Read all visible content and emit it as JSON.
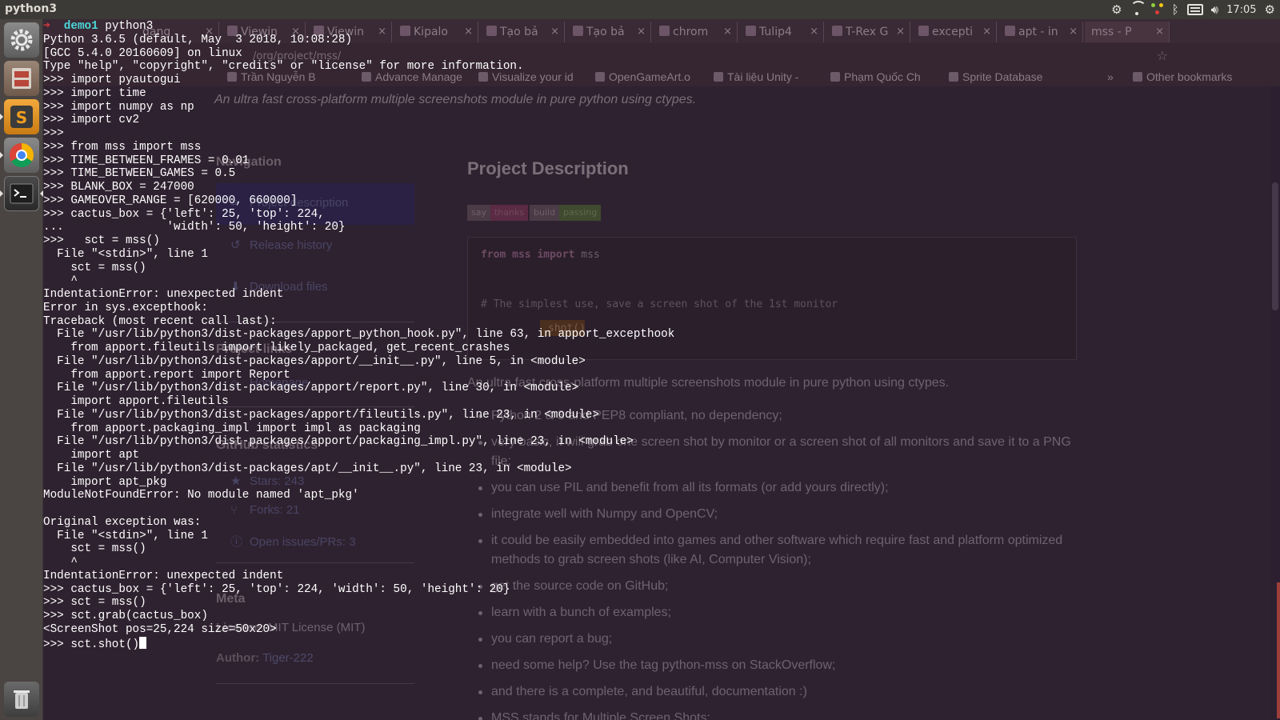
{
  "top_panel": {
    "app_title": "python3",
    "clock": "17:05",
    "tray_icons": [
      "settings-gear-icon",
      "wifi-icon",
      "network-shield-icon",
      "bluetooth-icon",
      "mail-icon",
      "volume-icon",
      "power-gear-icon"
    ]
  },
  "launcher": {
    "items": [
      "system-settings",
      "files",
      "sublime-text",
      "chrome",
      "terminal",
      "trash"
    ]
  },
  "browser": {
    "tabs": [
      {
        "label": "dang"
      },
      {
        "label": "Viewin"
      },
      {
        "label": "Viewin"
      },
      {
        "label": "Kipalo"
      },
      {
        "label": "Tạo bả"
      },
      {
        "label": "Tạo bả"
      },
      {
        "label": "chrom"
      },
      {
        "label": "Tulip4"
      },
      {
        "label": "T-Rex G"
      },
      {
        "label": "excepti"
      },
      {
        "label": "apt - in"
      },
      {
        "label": "mss - P"
      }
    ],
    "url": "/org/project/mss/",
    "bookmarks": [
      {
        "label": "Trần Nguyễn B"
      },
      {
        "label": "Advance Manage"
      },
      {
        "label": "Visualize your id"
      },
      {
        "label": "OpenGameArt.o"
      },
      {
        "label": "Tài liệu Unity -"
      },
      {
        "label": "Phạm Quốc Ch"
      },
      {
        "label": "Sprite Database"
      },
      {
        "label": "»"
      },
      {
        "label": "Other bookmarks"
      }
    ],
    "page": {
      "summary": "An ultra fast cross-platform multiple screenshots module in pure python using ctypes.",
      "sidebar": {
        "navigation_heading": "Navigation",
        "project_description_link": "Project description",
        "release_history_link": "Release history",
        "download_files_link": "Download files",
        "project_links_heading": "Project links",
        "homepage_link": "Homepage",
        "github_heading": "GitHub statistics",
        "stars": "Stars: 243",
        "forks": "Forks: 21",
        "issues": "Open issues/PRs: 3",
        "meta_heading": "Meta",
        "license_label": "License:",
        "license_value": "MIT License (MIT)",
        "author_label": "Author:",
        "author_value": "Tiger-222"
      },
      "main": {
        "title": "Project Description",
        "badge1_left": "say",
        "badge1_right": "thanks",
        "badge2_left": "build",
        "badge2_right": "passing",
        "code_kw_from": "from",
        "code_mod": "mss",
        "code_kw_import": "import",
        "code_name": "mss",
        "code_comment": "# The simplest use, save a screen shot of the 1st monitor",
        "code_call": "shot()",
        "paragraph": "An ultra fast cross-platform multiple screenshots module in pure python using ctypes.",
        "bullets": [
          {
            "text": "Python 2 & 3 and PEP8 compliant, no dependency;"
          },
          {
            "text": "very basic, it will grab one screen shot by monitor or a screen shot of all monitors and save it to a PNG file;"
          },
          {
            "text": "you can use PIL and benefit from all its formats (or add yours directly);"
          },
          {
            "text": "integrate well with Numpy and OpenCV;"
          },
          {
            "text": "it could be easily embedded into games and other software which require fast and platform optimized methods to grab screen shots (like AI, Computer Vision);"
          },
          {
            "text": "get the source code on GitHub;"
          },
          {
            "text": "learn with a bunch of examples;"
          },
          {
            "text": "you can report a bug;"
          },
          {
            "text": "need some help? Use the tag python-mss on StackOverflow;"
          },
          {
            "text": "and there is a complete, and beautiful, documentation :)"
          },
          {
            "text": "MSS stands for Multiple Screen Shots;"
          }
        ]
      }
    }
  },
  "terminal": {
    "prompt_arrow": "➜",
    "prompt_dir": "demo1",
    "prompt_cmd": " python3",
    "lines": [
      "Python 3.6.5 (default, May  3 2018, 10:08:28)",
      "[GCC 5.4.0 20160609] on linux",
      "Type \"help\", \"copyright\", \"credits\" or \"license\" for more information.",
      ">>> import pyautogui",
      ">>> import time",
      ">>> import numpy as np",
      ">>> import cv2",
      ">>> ",
      ">>> from mss import mss",
      ">>> TIME_BETWEEN_FRAMES = 0.01",
      ">>> TIME_BETWEEN_GAMES = 0.5",
      ">>> BLANK_BOX = 247000",
      ">>> GAMEOVER_RANGE = [620000, 660000]",
      ">>> cactus_box = {'left': 25, 'top': 224,",
      "...               'width': 50, 'height': 20}",
      ">>>   sct = mss()",
      "  File \"<stdin>\", line 1",
      "    sct = mss()",
      "    ^",
      "IndentationError: unexpected indent",
      "Error in sys.excepthook:",
      "Traceback (most recent call last):",
      "  File \"/usr/lib/python3/dist-packages/apport_python_hook.py\", line 63, in apport_excepthook",
      "    from apport.fileutils import likely_packaged, get_recent_crashes",
      "  File \"/usr/lib/python3/dist-packages/apport/__init__.py\", line 5, in <module>",
      "    from apport.report import Report",
      "  File \"/usr/lib/python3/dist-packages/apport/report.py\", line 30, in <module>",
      "    import apport.fileutils",
      "  File \"/usr/lib/python3/dist-packages/apport/fileutils.py\", line 23, in <module>",
      "    from apport.packaging_impl import impl as packaging",
      "  File \"/usr/lib/python3/dist-packages/apport/packaging_impl.py\", line 23, in <module>",
      "    import apt",
      "  File \"/usr/lib/python3/dist-packages/apt/__init__.py\", line 23, in <module>",
      "    import apt_pkg",
      "ModuleNotFoundError: No module named 'apt_pkg'",
      "",
      "Original exception was:",
      "  File \"<stdin>\", line 1",
      "    sct = mss()",
      "    ^",
      "IndentationError: unexpected indent",
      ">>> cactus_box = {'left': 25, 'top': 224, 'width': 50, 'height': 20}",
      ">>> sct = mss()",
      ">>> sct.grab(cactus_box)",
      "<ScreenShot pos=25,224 size=50x20>"
    ],
    "last_prompt": ">>> sct.shot()"
  },
  "colors": {
    "terminal_text": "#ffffff",
    "prompt_arrow": "#e03a3a",
    "prompt_dir": "#4ad7d7",
    "panel_bg": "#3b3a36",
    "launcher_bg": "#4a4543"
  }
}
